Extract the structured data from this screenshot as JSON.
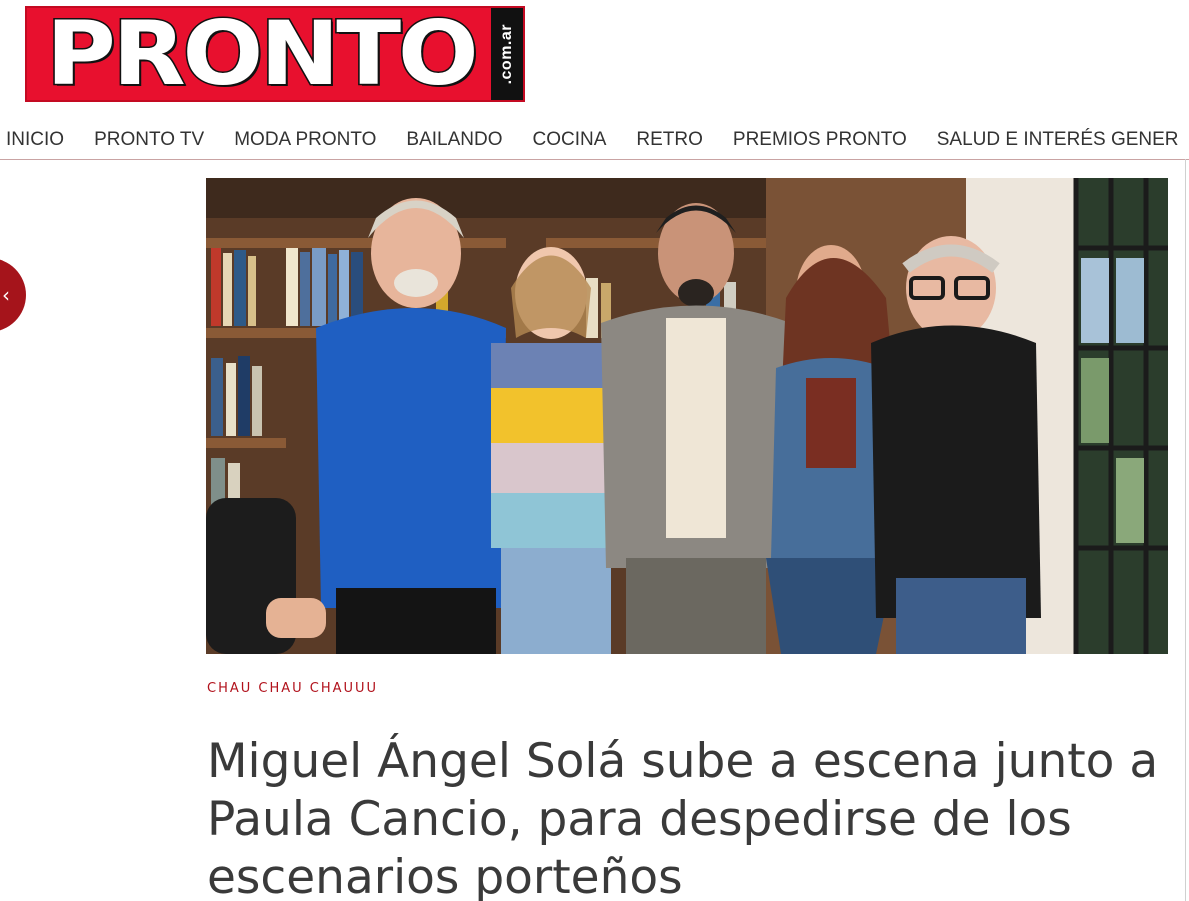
{
  "brand": {
    "logo_text": "PRONTO",
    "logo_domain": ".com.ar",
    "colors": {
      "primary": "#e8102e",
      "accent": "#a5141b",
      "kicker": "#b1121c",
      "text": "#3a3a3a"
    }
  },
  "nav": {
    "items": [
      "INICIO",
      "PRONTO TV",
      "MODA PRONTO",
      "BAILANDO",
      "COCINA",
      "RETRO",
      "PREMIOS PRONTO",
      "SALUD E INTERÉS GENER"
    ]
  },
  "side_arrow": {
    "icon": "chevron-left-icon",
    "glyph": "‹"
  },
  "article": {
    "kicker": "CHAU CHAU CHAUUU",
    "headline": "Miguel Ángel Solá sube a escena junto a Paula Cancio, para despedirse de los escenarios porteños"
  }
}
